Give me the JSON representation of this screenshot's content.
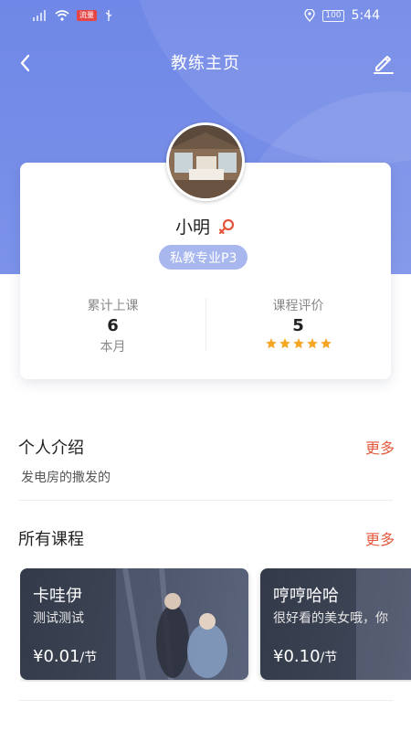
{
  "status_bar": {
    "time": "5:44",
    "carrier_badge": "流量",
    "battery": "100"
  },
  "nav": {
    "title": "教练主页"
  },
  "profile": {
    "name": "小明",
    "level": "私教专业P3",
    "stats": [
      {
        "label": "累计上课",
        "value": "6",
        "sub": "本月"
      },
      {
        "label": "课程评价",
        "value": "5",
        "rating": 5
      }
    ]
  },
  "intro": {
    "title": "个人介绍",
    "more": "更多",
    "text": "发电房的撒发的"
  },
  "courses": {
    "title": "所有课程",
    "more": "更多",
    "items": [
      {
        "name": "卡哇伊",
        "desc": "测试测试",
        "price": "¥0.01",
        "unit": "/节"
      },
      {
        "name": "哼哼哈哈",
        "desc": "很好看的美女哦，你",
        "price": "¥0.10",
        "unit": "/节"
      }
    ]
  },
  "colors": {
    "header": "#6f87e6",
    "accent_more": "#e35a3e",
    "badge": "#a9b7ef",
    "star": "#f5a623",
    "gender": "#e5553d"
  }
}
